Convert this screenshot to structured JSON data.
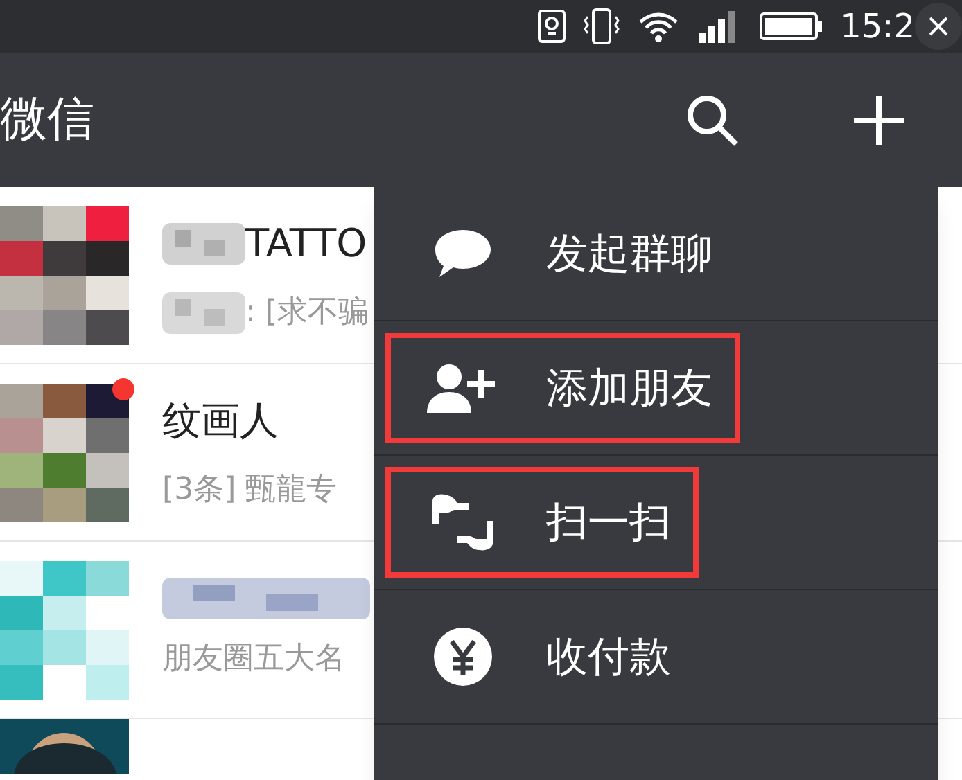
{
  "status_bar": {
    "time": "15:2"
  },
  "header": {
    "title": "微信"
  },
  "chats": [
    {
      "name": "TATTO",
      "name_mosaic": true,
      "preview": ": [求不骗",
      "preview_mosaic": true,
      "unread": false
    },
    {
      "name": "纹画人",
      "name_mosaic": false,
      "preview": "[3条] 甄龍专",
      "preview_mosaic": false,
      "unread": true
    },
    {
      "name_mosaic": true,
      "preview": "朋友圈五大名",
      "preview_mosaic": false,
      "unread": false
    }
  ],
  "menu": {
    "items": [
      {
        "kind": "chat",
        "label": "发起群聊",
        "highlighted": false
      },
      {
        "kind": "add-friend",
        "label": "添加朋友",
        "highlighted": true
      },
      {
        "kind": "scan",
        "label": "扫一扫",
        "highlighted": true
      },
      {
        "kind": "pay",
        "label": "收付款",
        "highlighted": false
      }
    ]
  }
}
